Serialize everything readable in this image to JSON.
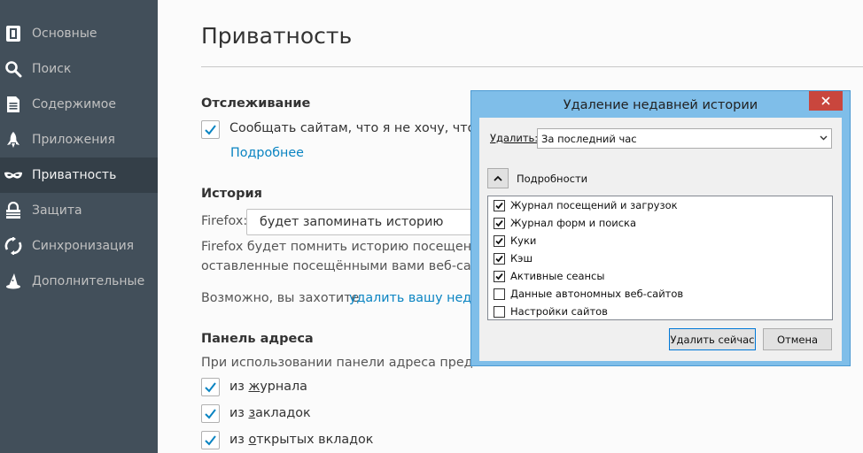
{
  "sidebar": {
    "items": [
      {
        "label": "Основные",
        "icon": "general-icon"
      },
      {
        "label": "Поиск",
        "icon": "search-icon"
      },
      {
        "label": "Содержимое",
        "icon": "document-icon"
      },
      {
        "label": "Приложения",
        "icon": "rocket-icon"
      },
      {
        "label": "Приватность",
        "icon": "mask-icon",
        "active": true
      },
      {
        "label": "Защита",
        "icon": "lock-icon"
      },
      {
        "label": "Синхронизация",
        "icon": "sync-icon"
      },
      {
        "label": "Дополнительные",
        "icon": "wizard-hat-icon"
      }
    ]
  },
  "main": {
    "title": "Приватность",
    "tracking": {
      "heading": "Отслеживание",
      "dnt_label": "Сообщать сайтам, что я не хочу, чтобы",
      "dnt_checked": true,
      "more_link": "Подробнее"
    },
    "history": {
      "heading": "История",
      "firefox_label": "Firefox:",
      "mode_value": "будет запоминать историю",
      "desc_line1": "Firefox будет помнить историю посещений,",
      "desc_line2": "оставленные посещёнными вами веб-сайта",
      "maybe_text": "Возможно, вы захотите",
      "clear_link": "удалить вашу недав"
    },
    "address_bar": {
      "heading": "Панель адреса",
      "desc": "При использовании панели адреса предла",
      "options": [
        {
          "prefix": "из ",
          "underlined": "ж",
          "rest": "урнала",
          "checked": true
        },
        {
          "prefix": "из ",
          "underlined": "з",
          "rest": "акладок",
          "checked": true
        },
        {
          "prefix": "из ",
          "underlined": "о",
          "rest": "ткрытых вкладок",
          "checked": true
        }
      ]
    }
  },
  "dialog": {
    "title": "Удаление недавней истории",
    "range_label": "Удалить:",
    "range_value": "За последний час",
    "details_label": "Подробности",
    "items": [
      {
        "label": "Журнал посещений и загрузок",
        "checked": true
      },
      {
        "label": "Журнал форм и поиска",
        "checked": true
      },
      {
        "label": "Куки",
        "checked": true
      },
      {
        "label": "Кэш",
        "checked": true
      },
      {
        "label": "Активные сеансы",
        "checked": true
      },
      {
        "label": "Данные автономных веб-сайтов",
        "checked": false
      },
      {
        "label": "Настройки сайтов",
        "checked": false
      }
    ],
    "clear_button": "Удалить сейчас",
    "cancel_button": "Отмена"
  },
  "colors": {
    "sidebar_bg": "#424f5a",
    "sidebar_active": "#343f48",
    "link": "#0a84c2",
    "dialog_frame": "#7fbee9",
    "close_red": "#c9463d"
  }
}
